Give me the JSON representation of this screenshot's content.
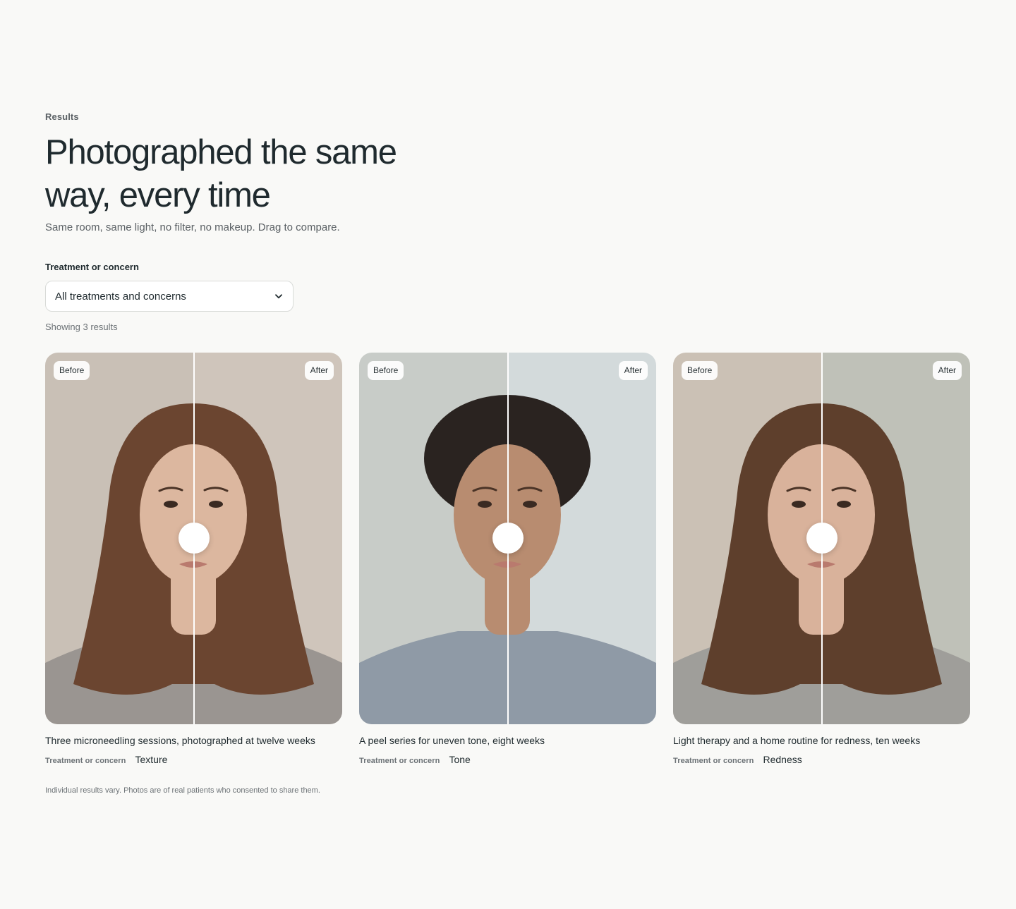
{
  "section": {
    "eyebrow": "Results",
    "headline": "Photographed the same way, every time",
    "subtitle": "Same room, same light, no filter, no makeup. Drag to compare."
  },
  "filter": {
    "label": "Treatment or concern",
    "selected": "All treatments and concerns",
    "icon": "chevron-down-icon"
  },
  "results_count": "Showing 3 results",
  "cards": [
    {
      "before_label": "Before",
      "after_label": "After",
      "caption": "Three microneedling sessions, photographed at twelve weeks",
      "meta_label": "Treatment or concern",
      "meta_value": "Texture",
      "slider_position": 0.5,
      "before_bg": "#c9c0b6",
      "after_bg": "#cfc5bb",
      "hair": "#6b4530",
      "skin": "#dcb79f",
      "shirt": "#9a9591"
    },
    {
      "before_label": "Before",
      "after_label": "After",
      "caption": "A peel series for uneven tone, eight weeks",
      "meta_label": "Treatment or concern",
      "meta_value": "Tone",
      "slider_position": 0.5,
      "before_bg": "#c8ccc8",
      "after_bg": "#d3dadb",
      "hair": "#2a2320",
      "skin": "#b88c70",
      "shirt": "#8f9aa6"
    },
    {
      "before_label": "Before",
      "after_label": "After",
      "caption": "Light therapy and a home routine for redness, ten weeks",
      "meta_label": "Treatment or concern",
      "meta_value": "Redness",
      "slider_position": 0.5,
      "before_bg": "#cbc1b5",
      "after_bg": "#bfc1b8",
      "hair": "#5e3f2c",
      "skin": "#d9b29b",
      "shirt": "#9f9e9a"
    }
  ],
  "disclaimer": "Individual results vary. Photos are of real patients who consented to share them."
}
